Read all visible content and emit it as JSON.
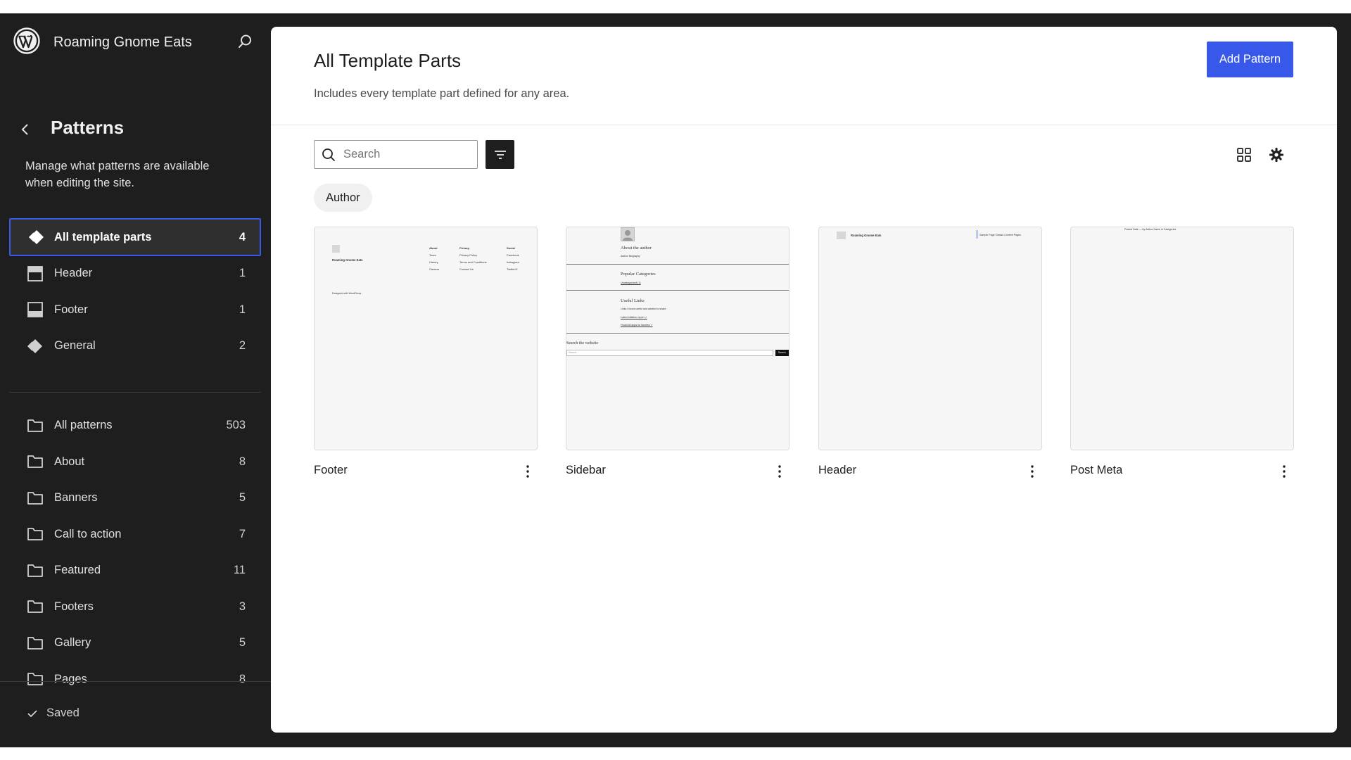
{
  "site": {
    "name": "Roaming Gnome Eats"
  },
  "sidebar": {
    "title": "Patterns",
    "description": "Manage what patterns are available when editing the site.",
    "template_parts": [
      {
        "label": "All template parts",
        "count": "4",
        "icon": "symbol-icon",
        "active": true
      },
      {
        "label": "Header",
        "count": "1",
        "icon": "header-icon"
      },
      {
        "label": "Footer",
        "count": "1",
        "icon": "footer-icon"
      },
      {
        "label": "General",
        "count": "2",
        "icon": "symbol-icon"
      }
    ],
    "categories": [
      {
        "label": "All patterns",
        "count": "503"
      },
      {
        "label": "About",
        "count": "8"
      },
      {
        "label": "Banners",
        "count": "5"
      },
      {
        "label": "Call to action",
        "count": "7"
      },
      {
        "label": "Featured",
        "count": "11"
      },
      {
        "label": "Footers",
        "count": "3"
      },
      {
        "label": "Gallery",
        "count": "5"
      },
      {
        "label": "Pages",
        "count": "8"
      }
    ],
    "status": "Saved"
  },
  "main": {
    "title": "All Template Parts",
    "description": "Includes every template part defined for any area.",
    "add_button": "Add Pattern",
    "search_placeholder": "Search",
    "filter_chip": "Author",
    "cards": [
      {
        "title": "Footer",
        "preview": {
          "site_name": "Roaming Gnome Eats",
          "col1": [
            "About",
            "Team",
            "History",
            "Careers"
          ],
          "col2": [
            "Privacy",
            "Privacy Policy",
            "Terms and Conditions",
            "Contact Us"
          ],
          "col3": [
            "Social",
            "Facebook",
            "Instagram",
            "Twitter/X"
          ],
          "credit": "Designed with WordPress"
        }
      },
      {
        "title": "Sidebar",
        "preview": {
          "about_heading": "About the author",
          "about_text": "Author Biography",
          "categories_heading": "Popular Categories",
          "categories_item": "Uncategorized (1)",
          "links_heading": "Useful Links",
          "links_text": "Links I found useful and wanted to share.",
          "link1": "Latest inflation report ↗",
          "link2": "Financial apps for families ↗",
          "search_heading": "Search the website",
          "search_placeholder": "Search...",
          "search_button": "Search"
        }
      },
      {
        "title": "Header",
        "preview": {
          "site_name": "Roaming Gnome Eats",
          "nav": "Sample Page  Classic Content Pages"
        }
      },
      {
        "title": "Post Meta",
        "preview": {
          "meta": "Posted Date — by Author Name in Categories"
        }
      }
    ]
  },
  "colors": {
    "sidebar_bg": "#1e1e1e",
    "accent": "#3858e9",
    "main_bg": "#ffffff"
  }
}
